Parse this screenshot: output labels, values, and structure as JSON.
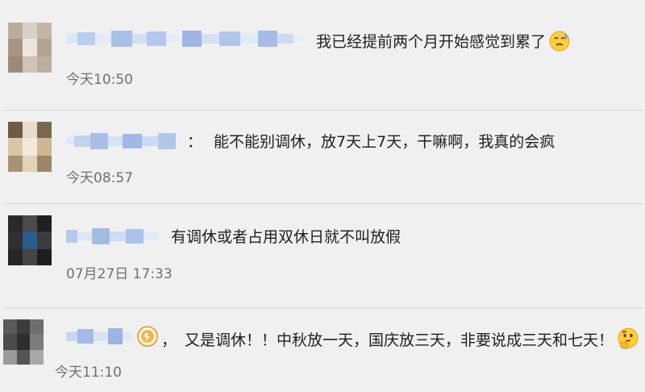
{
  "comments": [
    {
      "separator": "",
      "text": "我已经提前两个月开始感觉到累了",
      "emoji": "sweat-face-icon",
      "time": "今天10:50"
    },
    {
      "separator": "：",
      "text": "能不能别调休，放7天上7天，干嘛啊，我真的会疯",
      "time": "今天08:57"
    },
    {
      "separator": "",
      "text": "有调休或者占用双休日就不叫放假",
      "time": "07月27日 17:33"
    },
    {
      "separator": "，",
      "text": "又是调休！！中秋放一天，国庆放三天，非要说成三天和七天！",
      "badge": "orange-badge-icon",
      "emoji": "thinking-face-icon",
      "time": "今天11:10"
    }
  ],
  "colors": {
    "background": "#f0f0f0",
    "text": "#202020",
    "time": "#6f6f6f",
    "blur_tint": "#8fb0e0"
  }
}
